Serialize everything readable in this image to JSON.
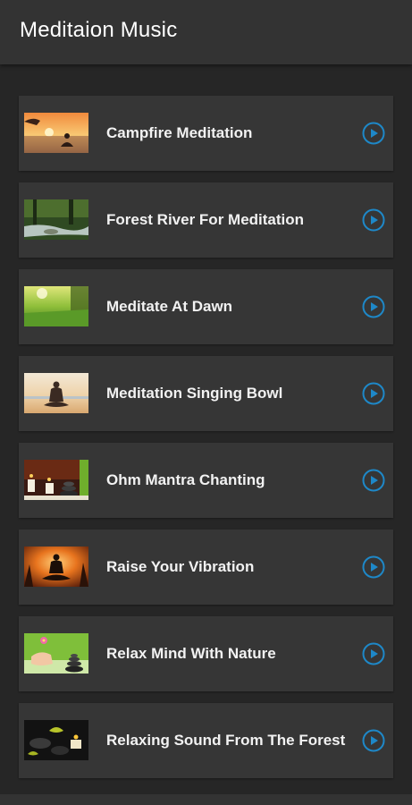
{
  "app": {
    "title": "Meditaion Music"
  },
  "colors": {
    "background": "#262626",
    "appbar": "#333333",
    "card": "#363636",
    "accent": "#1e88c8"
  },
  "tracks": [
    {
      "title": "Campfire Meditation",
      "thumbnail": "sunset-lake-meditation-image",
      "icon": "play-circle-icon"
    },
    {
      "title": "Forest River For Meditation",
      "thumbnail": "forest-river-image",
      "icon": "play-circle-icon"
    },
    {
      "title": "Meditate At Dawn",
      "thumbnail": "green-meadow-dawn-image",
      "icon": "play-circle-icon"
    },
    {
      "title": "Meditation Singing Bowl",
      "thumbnail": "beach-meditation-image",
      "icon": "play-circle-icon"
    },
    {
      "title": "Ohm Mantra Chanting",
      "thumbnail": "candles-stones-image",
      "icon": "play-circle-icon"
    },
    {
      "title": "Raise Your Vibration",
      "thumbnail": "sunset-silhouette-image",
      "icon": "play-circle-icon"
    },
    {
      "title": "Relax Mind With Nature",
      "thumbnail": "spa-flower-stones-image",
      "icon": "play-circle-icon"
    },
    {
      "title": "Relaxing Sound From The Forest",
      "thumbnail": "candle-stones-leaves-image",
      "icon": "play-circle-icon"
    }
  ]
}
